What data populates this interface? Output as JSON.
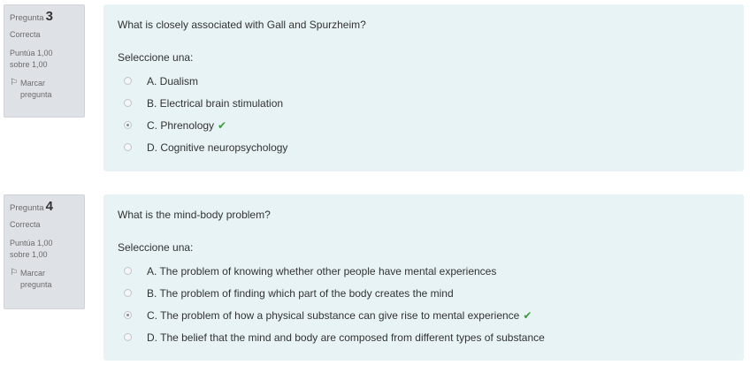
{
  "questions": [
    {
      "info": {
        "label": "Pregunta",
        "number": "3",
        "state": "Correcta",
        "grade_line1": "Puntúa 1,00",
        "grade_line2": "sobre 1,00",
        "flag_label_line1": "Marcar",
        "flag_label_line2": "pregunta",
        "flag_icon": "flag-icon"
      },
      "text": "What is closely associated with Gall and Spurzheim?",
      "prompt": "Seleccione una:",
      "options": [
        {
          "label": "A. Dualism",
          "checked": false,
          "correct": false
        },
        {
          "label": "B. Electrical brain stimulation",
          "checked": false,
          "correct": false
        },
        {
          "label": "C. Phrenology",
          "checked": true,
          "correct": true
        },
        {
          "label": "D. Cognitive neuropsychology",
          "checked": false,
          "correct": false
        }
      ]
    },
    {
      "info": {
        "label": "Pregunta",
        "number": "4",
        "state": "Correcta",
        "grade_line1": "Puntúa 1,00",
        "grade_line2": "sobre 1,00",
        "flag_label_line1": "Marcar",
        "flag_label_line2": "pregunta",
        "flag_icon": "flag-icon"
      },
      "text": "What is the mind-body problem?",
      "prompt": "Seleccione una:",
      "options": [
        {
          "label": "A. The problem of knowing whether other people have mental experiences",
          "checked": false,
          "correct": false
        },
        {
          "label": "B. The problem of finding which part of the body creates the mind",
          "checked": false,
          "correct": false
        },
        {
          "label": "C. The problem of how a physical substance can give rise to mental experience",
          "checked": true,
          "correct": true
        },
        {
          "label": "D. The belief that the mind and body are composed from different types of substance",
          "checked": false,
          "correct": false
        }
      ]
    }
  ],
  "colors": {
    "info_bg": "#dee2e6",
    "content_bg": "#e7f3f5",
    "correct_check": "#3a9c3a"
  }
}
